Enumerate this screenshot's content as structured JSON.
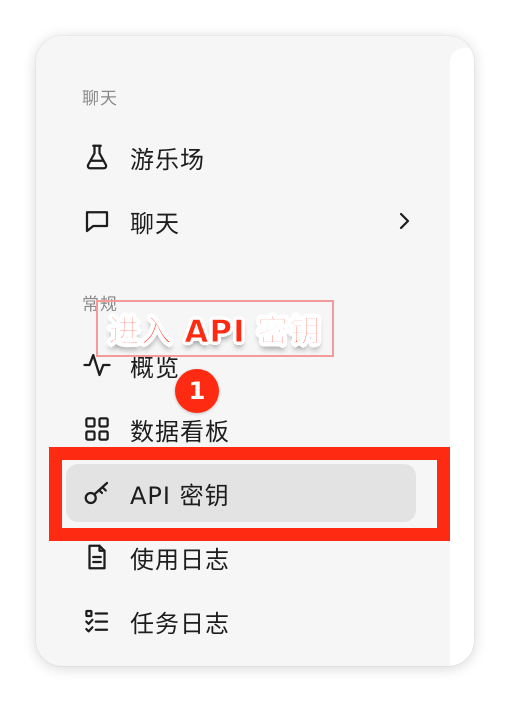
{
  "sidebar": {
    "sections": [
      {
        "label": "聊天"
      },
      {
        "label": "常规"
      }
    ],
    "items": [
      {
        "label": "游乐场",
        "icon": "flask-icon"
      },
      {
        "label": "聊天",
        "icon": "chat-bubble-icon",
        "has_submenu": true
      },
      {
        "label": "概览",
        "icon": "activity-pulse-icon"
      },
      {
        "label": "数据看板",
        "icon": "grid-dashboard-icon"
      },
      {
        "label": "API 密钥",
        "icon": "key-icon",
        "active": true
      },
      {
        "label": "使用日志",
        "icon": "document-icon"
      },
      {
        "label": "任务日志",
        "icon": "task-list-icon"
      }
    ]
  },
  "annotation": {
    "callout_text": "进入 API 密钥",
    "step_number": "1",
    "highlight_color": "#ff2a12"
  },
  "colors": {
    "card_background": "#f6f6f6",
    "active_item_background": "#e3e3e3",
    "section_label": "#8a8a8a",
    "text": "#1d1d1d"
  }
}
